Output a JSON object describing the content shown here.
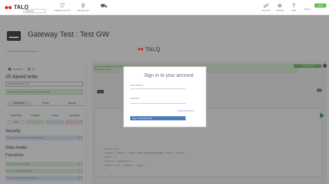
{
  "app": {
    "logo": "TALQ"
  },
  "topbar": {
    "env_select": "Gateway",
    "nav": [
      {
        "icon": "gateway-icon",
        "label": "Gateway test tool"
      },
      {
        "icon": "pipe-icon",
        "label": "Gateway test"
      },
      {
        "icon": "car-icon",
        "label": ""
      }
    ],
    "right_nav": [
      {
        "icon": "users-icon",
        "label": "Accounts"
      },
      {
        "icon": "gear-icon",
        "label": "Settings"
      },
      {
        "icon": "help-icon",
        "label": "Help"
      },
      {
        "icon": "user-icon",
        "label": "Sign in"
      }
    ],
    "version": "v1.0"
  },
  "gateway": {
    "title": "Gateway Test : Test GW",
    "subtitle": "Test Gateway certification test tool"
  },
  "left": {
    "radio": [
      {
        "label": "Connected",
        "on": true
      },
      {
        "label": "Idle",
        "on": false
      }
    ],
    "saved_title": "25 Saved tests",
    "saved_select": "Select saved test to run",
    "green_note": "Gateway is connected to server, ready for test",
    "tabs": [
      "Automatic",
      "Profile",
      "Manual"
    ],
    "stats_headers": [
      "Total Pass",
      "Passed",
      "Failed",
      "Cancelled"
    ],
    "stats_values": [
      "12/12",
      "",
      "",
      ""
    ],
    "security_title": "Security",
    "security_rows": [
      "CA_A_01 Connection and authentication"
    ],
    "datamodel_title": "Data model",
    "functions_title": "Functions",
    "function_rows": [
      "CA_FT_01 Basic function",
      "CA_FT_02 Control function",
      "CA_FT_03 Configuration function"
    ]
  },
  "right": {
    "green_text": "OK: Test completed successfully",
    "green_text2": "Test results saved",
    "badge": "Test Passed",
    "code_lines": [
      "return: true,",
      "\"result\": success, \"time\": 2019-01-01T00:00:00Z, \"test\": \"report\"",
      "\"data\": {",
      "  \"device\": \"controller\",",
      "  \"state\": \"on\", \"status\": \"ready\"",
      "}"
    ]
  },
  "modal": {
    "logo": "TALQ",
    "title": "Sign in to your account",
    "email_label": "Email address",
    "password_label": "Password",
    "forgot": "Forgot password?",
    "signin": "Sign in with Microsoft"
  }
}
